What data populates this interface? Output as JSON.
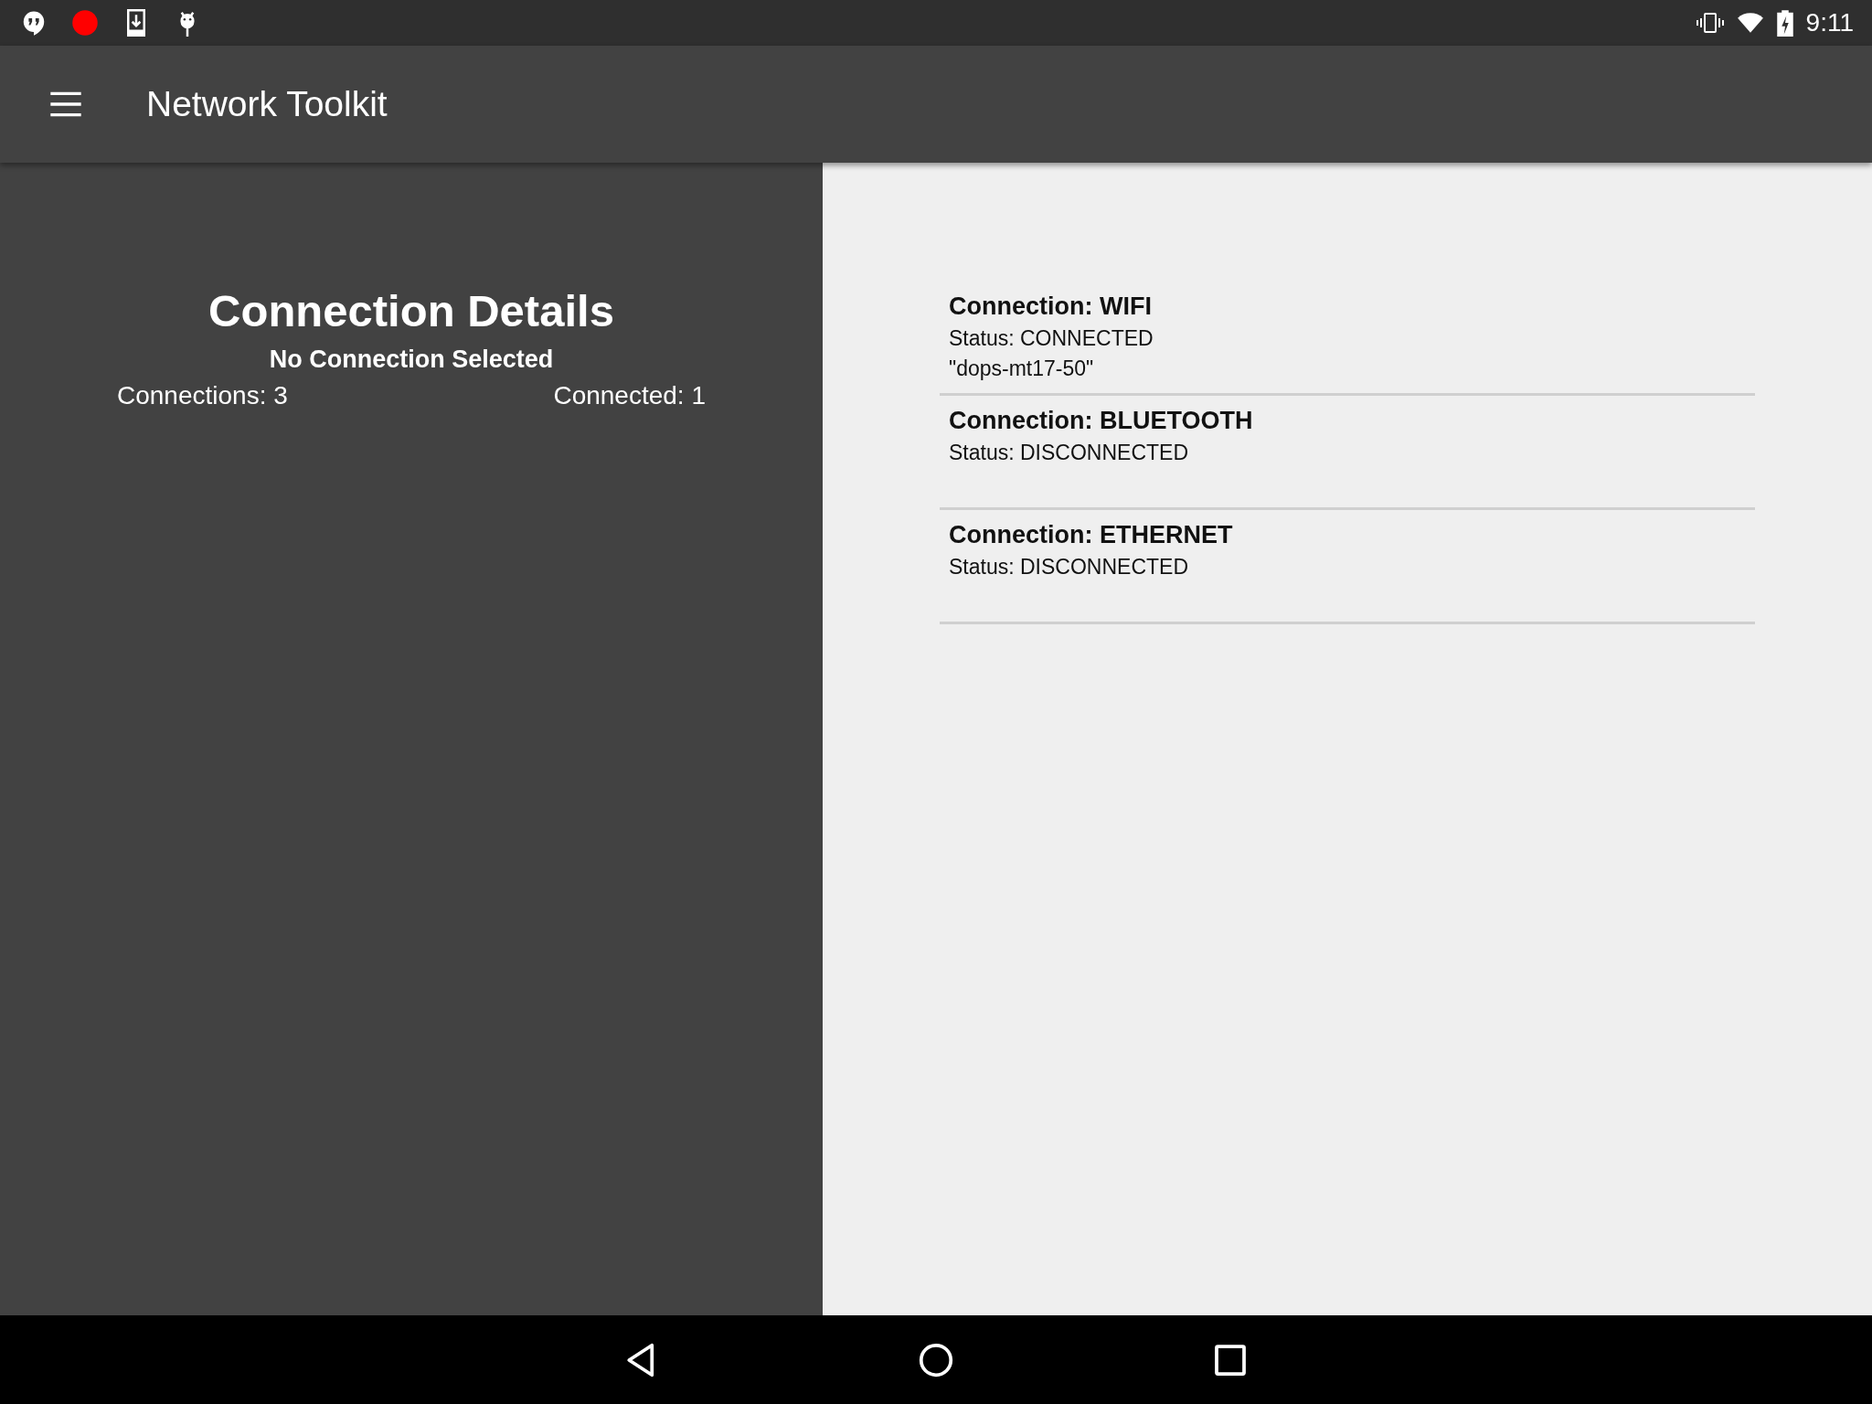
{
  "status_bar": {
    "time": "9:11"
  },
  "app_bar": {
    "title": "Network Toolkit"
  },
  "details": {
    "title": "Connection Details",
    "subtitle": "No Connection Selected",
    "connections": "Connections: 3",
    "connected": "Connected: 1"
  },
  "connections": [
    {
      "title": "Connection: WIFI",
      "status": "Status: CONNECTED",
      "network": "\"dops-mt17-50\""
    },
    {
      "title": "Connection: BLUETOOTH",
      "status": "Status: DISCONNECTED"
    },
    {
      "title": "Connection: ETHERNET",
      "status": "Status: DISCONNECTED"
    }
  ]
}
